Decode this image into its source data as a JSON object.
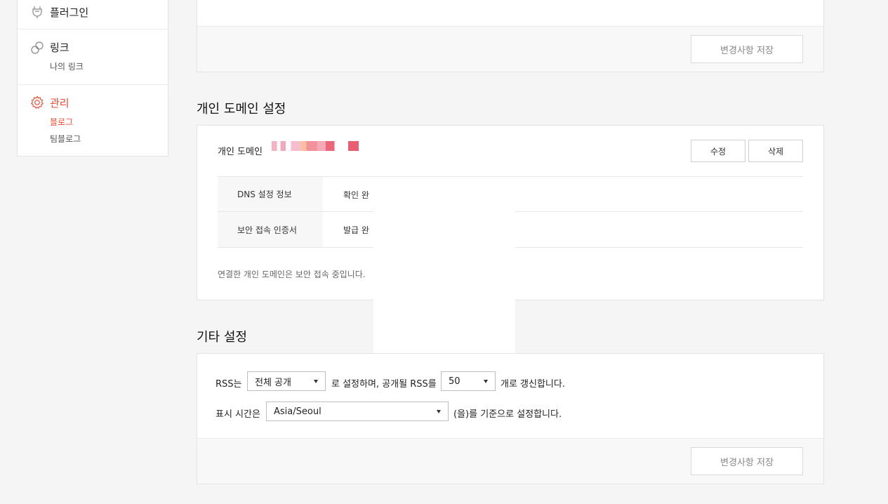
{
  "sidebar": {
    "plugin": {
      "label": "플러그인"
    },
    "link": {
      "label": "링크",
      "sub": "나의 링크"
    },
    "manage": {
      "label": "관리",
      "subs": [
        "블로그",
        "팀블로그"
      ]
    }
  },
  "top_box": {
    "save_label": "변경사항 저장"
  },
  "domain_section": {
    "title": "개인 도메인 설정",
    "domain_label": "개인 도메인",
    "edit_label": "수정",
    "delete_label": "삭제",
    "rows": [
      {
        "key": "DNS 설정 정보",
        "value": "확인 완"
      },
      {
        "key": "보안 접속 인증서",
        "value": "발급 완"
      }
    ],
    "note": "연결한 개인 도메인은 보안 접속 중입니다."
  },
  "other_section": {
    "title": "기타 설정",
    "rss_prefix": "RSS는",
    "rss_visibility": "전체 공개",
    "rss_middle": "로 설정하며, 공개될 RSS를",
    "rss_count": "50",
    "rss_suffix": "개로 갱신합니다.",
    "time_prefix": "표시 시간은",
    "timezone": "Asia/Seoul",
    "time_suffix": "(을)를 기준으로 설정합니다.",
    "save_label": "변경사항 저장"
  },
  "colors": {
    "accent": "#ee4b33",
    "background": "#f5f5f5"
  }
}
